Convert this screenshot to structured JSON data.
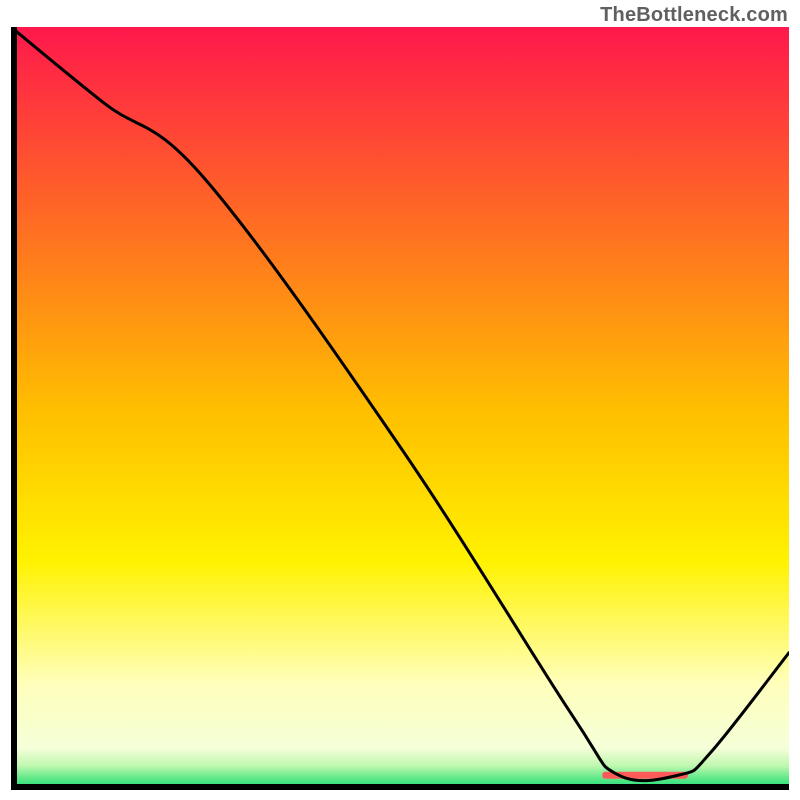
{
  "watermark": "TheBottleneck.com",
  "chart_data": {
    "type": "line",
    "title": "",
    "xlabel": "",
    "ylabel": "",
    "xlim": [
      0,
      100
    ],
    "ylim": [
      0,
      100
    ],
    "grid": false,
    "legend": false,
    "background": {
      "type": "vertical-gradient",
      "stops": [
        {
          "pos": 0.0,
          "color": "#ff184c"
        },
        {
          "pos": 0.25,
          "color": "#ff6a24"
        },
        {
          "pos": 0.5,
          "color": "#ffbe00"
        },
        {
          "pos": 0.7,
          "color": "#fff200"
        },
        {
          "pos": 0.86,
          "color": "#ffffbb"
        },
        {
          "pos": 0.945,
          "color": "#f5ffd8"
        },
        {
          "pos": 0.968,
          "color": "#c0f8b0"
        },
        {
          "pos": 0.985,
          "color": "#5de887"
        },
        {
          "pos": 1.0,
          "color": "#14df7a"
        }
      ]
    },
    "series": [
      {
        "name": "curve",
        "color": "#000000",
        "x": [
          0,
          12,
          25,
          50,
          72,
          78,
          86,
          90,
          100
        ],
        "y": [
          100,
          90,
          80,
          45,
          10,
          2,
          2,
          5,
          18
        ]
      }
    ],
    "marker_band": {
      "name": "optimum-band",
      "color": "#ff5a5a",
      "x_start": 76,
      "x_end": 87,
      "y": 2
    }
  }
}
